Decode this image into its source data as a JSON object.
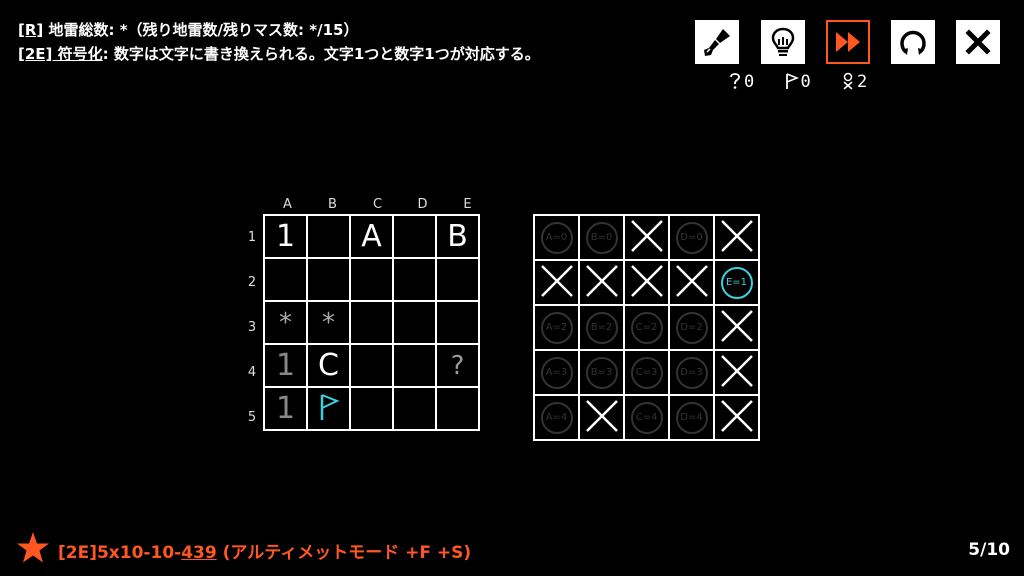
{
  "rules": {
    "line1_tag": "[R]",
    "line1_text": " 地雷総数: *（残り地雷数/残りマス数: */15）",
    "line2_tag": "[2E] 符号化",
    "line2_text": ": 数字は文字に書き換えられる。文字1つと数字1つが対応する。"
  },
  "toolbar": {
    "buttons": [
      {
        "name": "brush-button",
        "icon": "brush-icon"
      },
      {
        "name": "hint-button",
        "icon": "lightbulb-icon"
      },
      {
        "name": "fast-forward-button",
        "icon": "fast-forward-icon"
      },
      {
        "name": "restart-button",
        "icon": "restart-icon"
      },
      {
        "name": "close-button",
        "icon": "close-icon"
      }
    ],
    "accent_color": "#ff5722"
  },
  "counters": {
    "question": "0",
    "flag": "0",
    "mine": "2"
  },
  "board": {
    "columns": [
      "A",
      "B",
      "C",
      "D",
      "E"
    ],
    "rows": [
      "1",
      "2",
      "3",
      "4",
      "5"
    ],
    "cells": [
      [
        "1",
        "",
        "A",
        "",
        "B"
      ],
      [
        "",
        "",
        "",
        "",
        ""
      ],
      [
        "*",
        "*",
        "",
        "",
        ""
      ],
      [
        "1",
        "C",
        "",
        "",
        "?"
      ],
      [
        "1",
        "flag",
        "",
        "",
        ""
      ]
    ]
  },
  "candidates": {
    "cells": [
      [
        "A=0",
        "B=0",
        "X",
        "D=0",
        "X"
      ],
      [
        "X",
        "X",
        "X",
        "X",
        "E=1"
      ],
      [
        "A=2",
        "B=2",
        "C=2",
        "D=2",
        "X"
      ],
      [
        "A=3",
        "B=3",
        "C=3",
        "D=3",
        "X"
      ],
      [
        "A=4",
        "X",
        "C=4",
        "D=4",
        "X"
      ]
    ],
    "selected": "E=1",
    "selected_color": "#3fd0e0"
  },
  "footer": {
    "prefix": "[2E]5x10-10-",
    "number": "439",
    "suffix": " (アルティメットモード +F +S)"
  },
  "progress": "5/10"
}
